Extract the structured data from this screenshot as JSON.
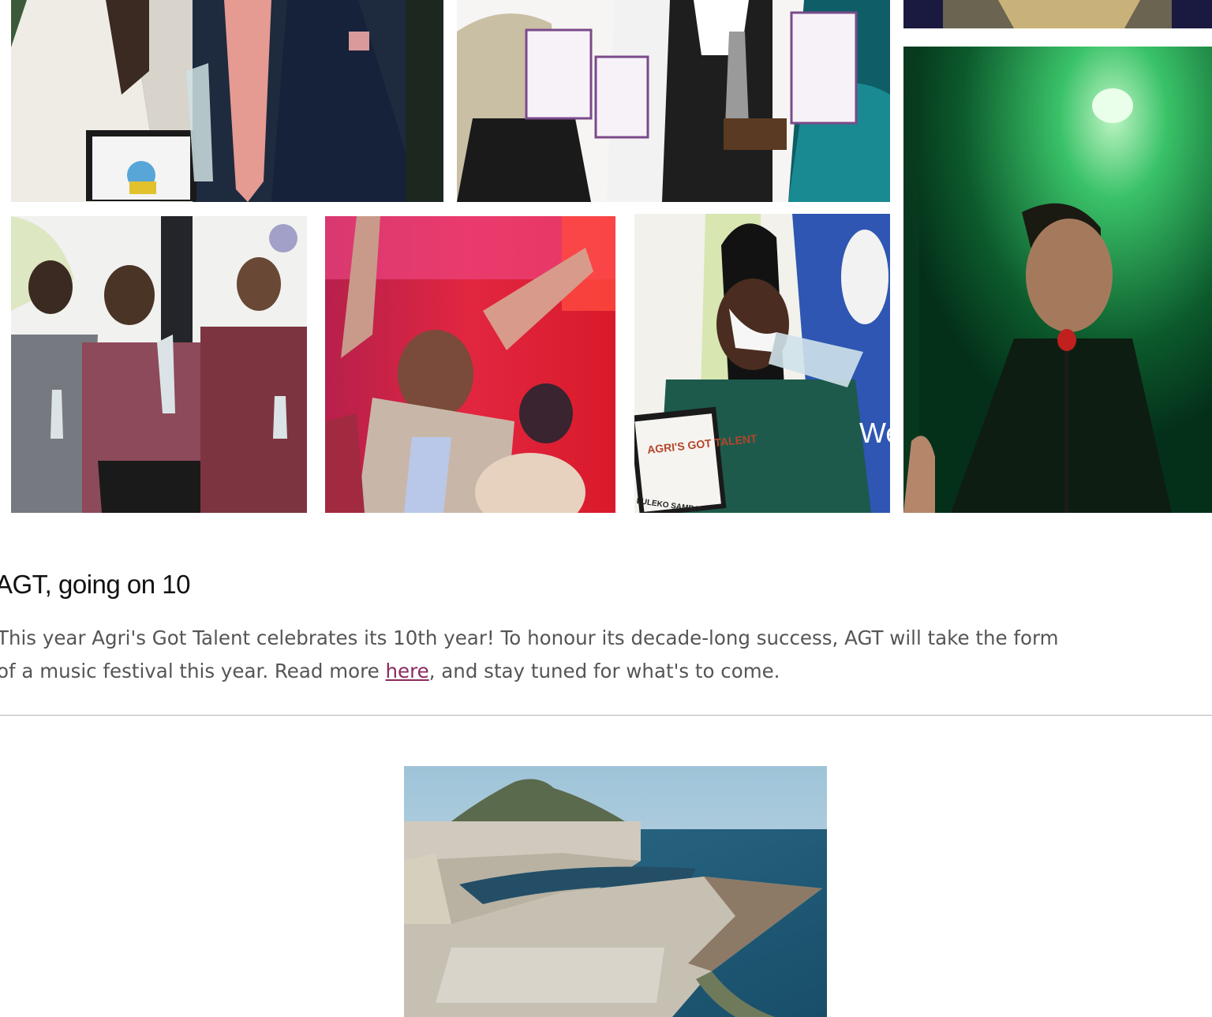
{
  "article": {
    "title": "AGT, going on 10",
    "body_line1": "This year Agri's Got Talent celebrates its 10th year! To honour its decade-long success, AGT will take the form",
    "body_line2_before_link": "of a music festival this year. Read more ",
    "link_text": "here",
    "body_line2_after_link": ", and stay tuned for what's to come."
  },
  "collage": {
    "tiles": [
      {
        "id": "p1",
        "description_icon": "award-winners-photo"
      },
      {
        "id": "p2",
        "description_icon": "certificate-holders-photo"
      },
      {
        "id": "p3",
        "description_icon": "performer-photo-top"
      },
      {
        "id": "p4",
        "description_icon": "singer-green-light-photo"
      },
      {
        "id": "p5",
        "description_icon": "three-winners-photo"
      },
      {
        "id": "p6",
        "description_icon": "audience-photo"
      },
      {
        "id": "p7",
        "description_icon": "trophy-winner-photo"
      }
    ],
    "certificate_text": "AGRI'S GOT TALENT",
    "certificate_name": "LULEKO SAMBO",
    "banner_fragment": "Wes Go"
  },
  "feature_image": {
    "icon": "harbour-aerial-photo"
  },
  "colors": {
    "link": "#8a2a5e",
    "body_text": "#555555",
    "heading": "#111111",
    "divider": "#b5b5b5"
  }
}
